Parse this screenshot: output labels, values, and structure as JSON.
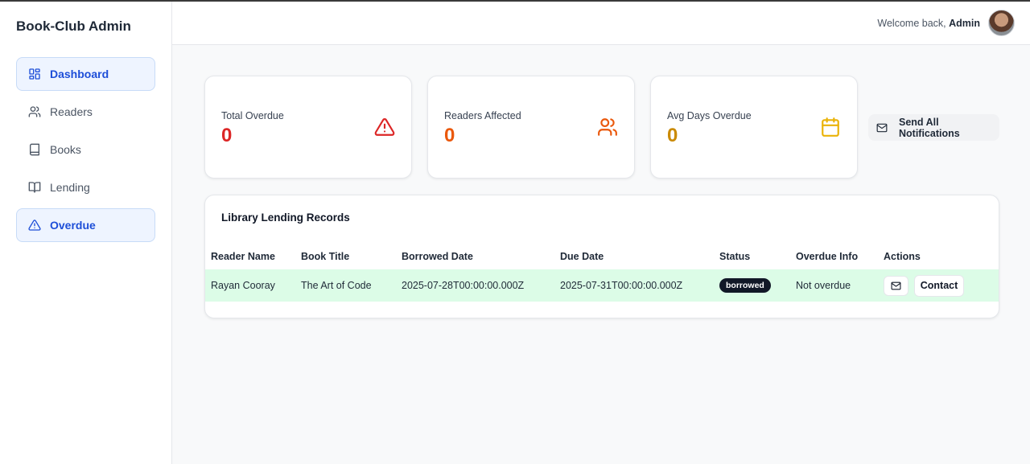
{
  "sidebar": {
    "brand": "Book-Club Admin",
    "items": [
      {
        "label": "Dashboard",
        "icon": "dashboard-icon",
        "active": true
      },
      {
        "label": "Readers",
        "icon": "users-icon",
        "active": false
      },
      {
        "label": "Books",
        "icon": "book-icon",
        "active": false
      },
      {
        "label": "Lending",
        "icon": "open-book-icon",
        "active": false
      },
      {
        "label": "Overdue",
        "icon": "alert-triangle-icon",
        "active": true
      }
    ]
  },
  "header": {
    "welcome_prefix": "Welcome back,",
    "user_name": "Admin"
  },
  "stats": [
    {
      "label": "Total Overdue",
      "value": "0",
      "color": "#dc2626",
      "icon": "alert-triangle-icon"
    },
    {
      "label": "Readers Affected",
      "value": "0",
      "color": "#ea580c",
      "icon": "users-icon"
    },
    {
      "label": "Avg Days Overdue",
      "value": "0",
      "color": "#ca8a04",
      "icon": "calendar-icon"
    }
  ],
  "actions": {
    "send_all_label": "Send All Notifications"
  },
  "records": {
    "title": "Library Lending Records",
    "columns": [
      "Reader Name",
      "Book Title",
      "Borrowed Date",
      "Due Date",
      "Status",
      "Overdue Info",
      "Actions"
    ],
    "rows": [
      {
        "reader": "Rayan Cooray",
        "book": "The Art of Code",
        "borrowed": "2025-07-28T00:00:00.000Z",
        "due": "2025-07-31T00:00:00.000Z",
        "status": "borrowed",
        "overdue_info": "Not overdue",
        "contact_label": "Contact"
      }
    ]
  },
  "colors": {
    "accent": "#1d4ed8",
    "row_highlight": "#dcfce7"
  }
}
